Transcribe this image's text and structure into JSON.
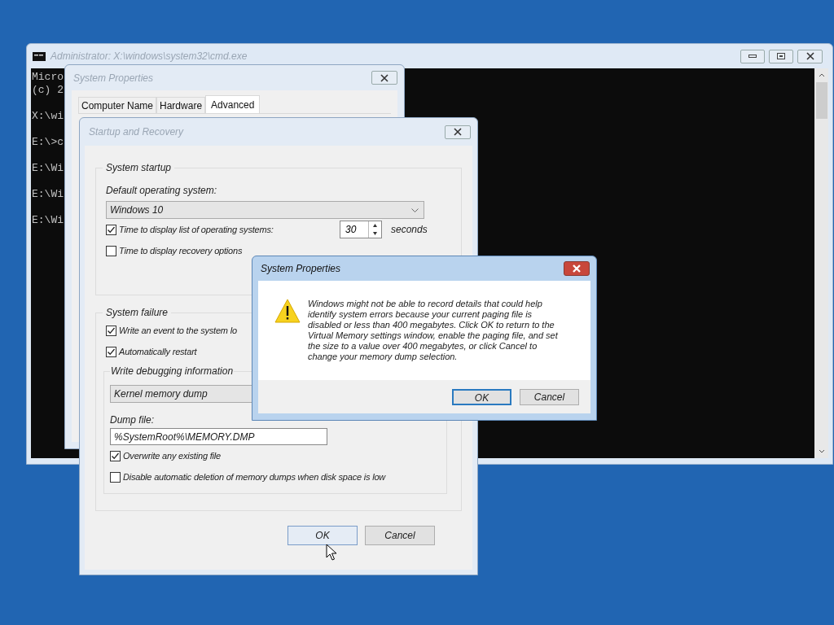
{
  "console": {
    "title": "Administrator: X:\\windows\\system32\\cmd.exe",
    "blocks": [
      [
        "Micro",
        "(c) 2"
      ],
      [
        "X:\\wi"
      ],
      [
        "E:\\>c"
      ],
      [
        "E:\\Wi"
      ],
      [
        "E:\\Wi"
      ],
      [
        "E:\\Wi"
      ]
    ]
  },
  "system_properties": {
    "title": "System Properties",
    "tabs": [
      {
        "label": "Computer Name",
        "selected": false
      },
      {
        "label": "Hardware",
        "selected": false
      },
      {
        "label": "Advanced",
        "selected": true
      }
    ]
  },
  "startup_recovery": {
    "title": "Startup and Recovery",
    "system_startup": {
      "legend": "System startup",
      "default_os_label": "Default operating system:",
      "default_os": "Windows 10",
      "options": [
        {
          "label": "Time to display list of operating systems:",
          "checked": true,
          "value": "30",
          "unit": "seconds"
        },
        {
          "label": "Time to display recovery options",
          "checked": false
        }
      ]
    },
    "system_failure": {
      "legend": "System failure",
      "options": [
        {
          "label": "Write an event to the system lo",
          "checked": true
        },
        {
          "label": "Automatically restart",
          "checked": true
        }
      ],
      "debug": {
        "legend": "Write debugging information",
        "dump_type": "Kernel memory dump",
        "dump_file_label": "Dump file:",
        "dump_file": "%SystemRoot%\\MEMORY.DMP",
        "options": [
          {
            "label": "Overwrite any existing file",
            "checked": true
          },
          {
            "label": "Disable automatic deletion of memory dumps when disk space is low",
            "checked": false
          }
        ]
      }
    },
    "buttons": [
      "OK",
      "Cancel"
    ]
  },
  "alert": {
    "title": "System Properties",
    "message": "Windows might not be able to record details that could help identify system errors because your current paging file is disabled or less than 400 megabytes. Click OK to return to the Virtual Memory settings window, enable the paging file, and set the size to a value over 400 megabytes, or click Cancel to change your memory dump selection.",
    "buttons": [
      {
        "label": "OK",
        "default": true
      },
      {
        "label": "Cancel",
        "default": false
      }
    ]
  }
}
